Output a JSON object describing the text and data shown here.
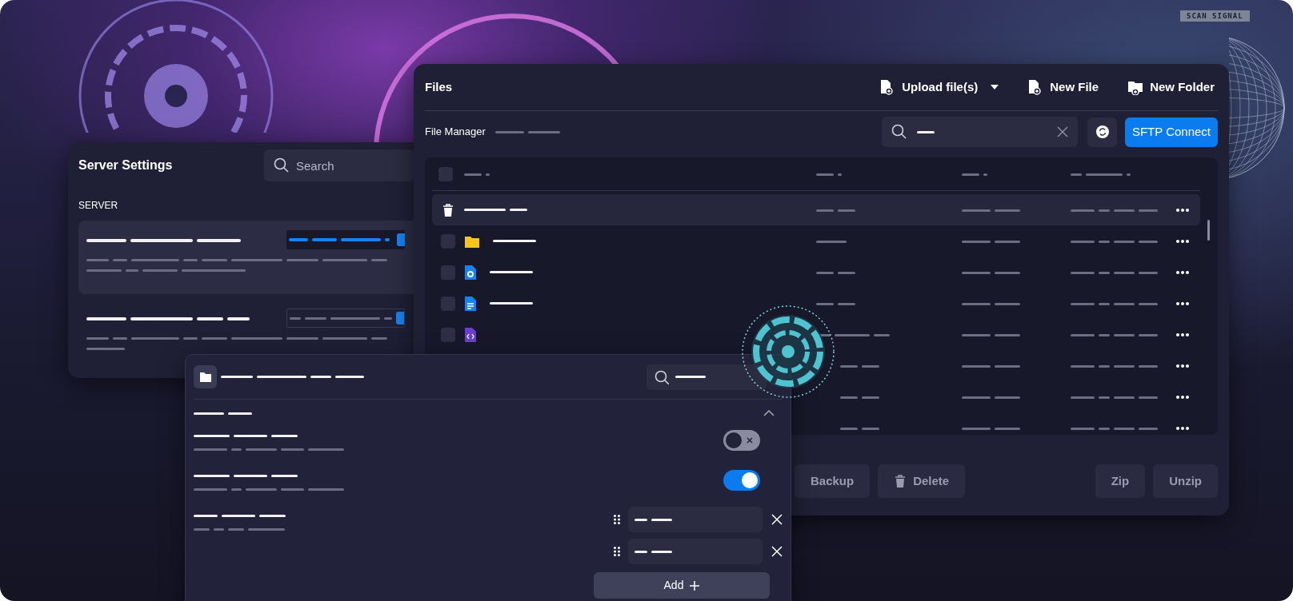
{
  "background": {
    "label": "SCAN SIGNAL"
  },
  "server_settings": {
    "title": "Server Settings",
    "search": {
      "placeholder": "Search"
    },
    "section": "SERVER",
    "items": [
      {
        "selected": true
      },
      {
        "selected": false
      }
    ]
  },
  "files": {
    "title": "Files",
    "actions": [
      {
        "label": "Upload file(s)",
        "kind": "upload"
      },
      {
        "label": "New File",
        "kind": "new-file"
      },
      {
        "label": "New Folder",
        "kind": "new-folder"
      }
    ],
    "breadcrumb": "File Manager",
    "connect_button": "SFTP Connect",
    "select_all_checked": false,
    "rows": [
      {
        "kind": "trash",
        "highlighted": true
      },
      {
        "kind": "folder",
        "highlighted": false,
        "checked": false
      },
      {
        "kind": "gear-file",
        "highlighted": false,
        "checked": false
      },
      {
        "kind": "doc-file",
        "highlighted": false,
        "checked": false
      },
      {
        "kind": "code-file",
        "highlighted": false,
        "checked": false
      },
      {
        "kind": "plain",
        "highlighted": false
      },
      {
        "kind": "plain",
        "highlighted": false
      },
      {
        "kind": "plain",
        "highlighted": false
      }
    ],
    "buttons": [
      {
        "label": "Backup",
        "kind": "plain"
      },
      {
        "label": "Delete",
        "kind": "trash"
      },
      {
        "label": "Zip",
        "kind": "plain"
      },
      {
        "label": "Unzip",
        "kind": "plain"
      }
    ]
  },
  "settings_panel": {
    "rows": [
      {
        "kind": "toggle",
        "on": false
      },
      {
        "kind": "toggle",
        "on": true
      },
      {
        "kind": "list"
      }
    ],
    "list_items": [
      {
        "kind": "field"
      },
      {
        "kind": "field"
      }
    ],
    "add_button": "Add"
  }
}
